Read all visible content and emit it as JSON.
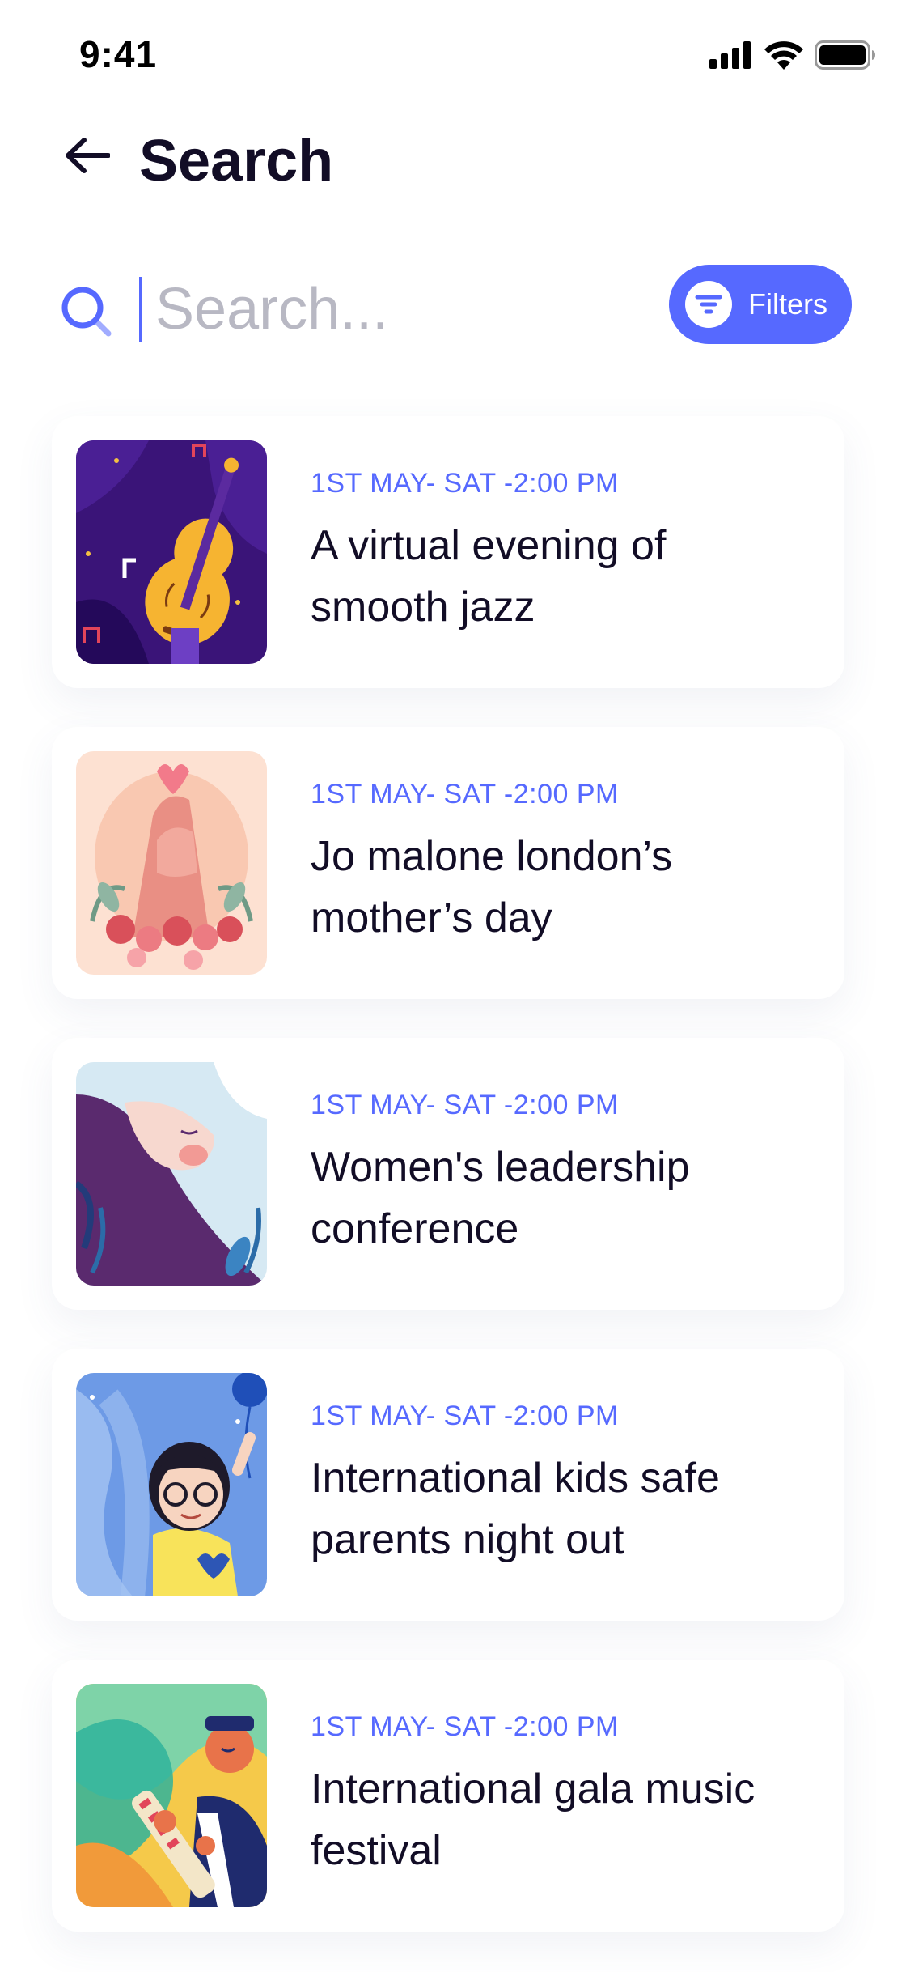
{
  "status_bar": {
    "time": "9:41"
  },
  "header": {
    "title": "Search"
  },
  "search": {
    "placeholder": "Search...",
    "value": "",
    "filters_label": "Filters"
  },
  "colors": {
    "accent": "#5669ff",
    "text_primary": "#120d26",
    "placeholder": "#b8b8c3"
  },
  "icons": {
    "back": "arrow-left-icon",
    "search": "search-icon",
    "filters": "filter-icon",
    "signal": "cellular-signal-icon",
    "wifi": "wifi-icon",
    "battery": "battery-icon"
  },
  "events": [
    {
      "date": "1ST  MAY- SAT -2:00 PM",
      "title": "A virtual evening of smooth jazz"
    },
    {
      "date": "1ST  MAY- SAT -2:00 PM",
      "title": "Jo malone london’s mother’s day"
    },
    {
      "date": "1ST  MAY- SAT -2:00 PM",
      "title": "Women's leadership conference"
    },
    {
      "date": "1ST  MAY- SAT -2:00 PM",
      "title": "International kids safe parents night out"
    },
    {
      "date": "1ST  MAY- SAT -2:00 PM",
      "title": "International gala music festival"
    }
  ]
}
